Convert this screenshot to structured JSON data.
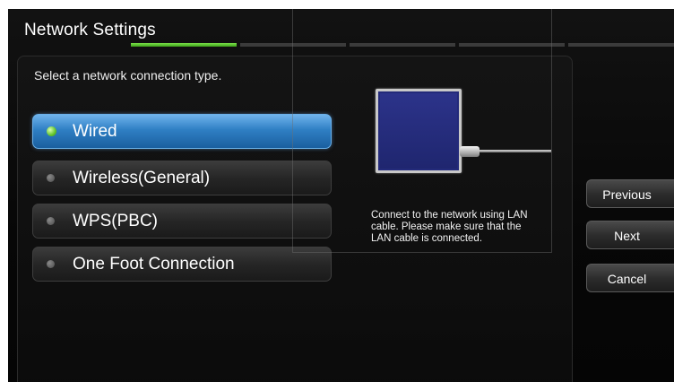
{
  "screen": {
    "title": "Network Settings",
    "progress": {
      "total_steps": 5,
      "current_step": 1
    }
  },
  "main": {
    "instruction": "Select a network connection type.",
    "options": [
      {
        "label": "Wired",
        "selected": true
      },
      {
        "label": "Wireless(General)",
        "selected": false
      },
      {
        "label": "WPS(PBC)",
        "selected": false
      },
      {
        "label": "One Foot Connection",
        "selected": false
      }
    ],
    "illustration": {
      "icon": "tv-lan-cable-icon"
    },
    "description": "Connect to the network using LAN cable. Please make sure that the LAN cable is connected."
  },
  "buttons": {
    "previous": "Previous",
    "next": "Next",
    "cancel": "Cancel"
  },
  "colors": {
    "selected_accent": "#2f7fc4",
    "selected_indicator": "#62c42a",
    "progress_active": "#3ea21a",
    "background": "#070707"
  }
}
